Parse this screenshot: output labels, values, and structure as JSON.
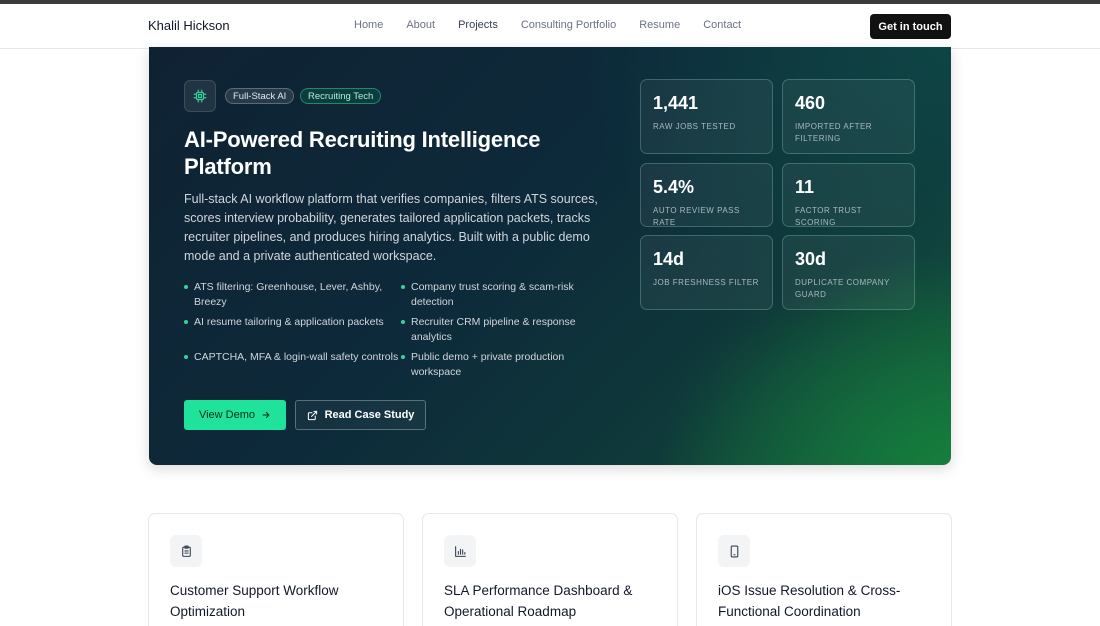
{
  "nav": {
    "brand": "Khalil Hickson",
    "links": [
      "Home",
      "About",
      "Projects",
      "Consulting Portfolio",
      "Resume",
      "Contact"
    ],
    "active": "Projects",
    "cta": "Get in touch"
  },
  "hero": {
    "tags": [
      "Full-Stack AI",
      "Recruiting Tech"
    ],
    "title": "AI-Powered Recruiting Intelligence Platform",
    "description": "Full-stack AI workflow platform that verifies companies, filters ATS sources, scores interview probability, generates tailored application packets, tracks recruiter pipelines, and produces hiring analytics. Built with a public demo mode and a private authenticated workspace.",
    "bullets": [
      "ATS filtering: Greenhouse, Lever, Ashby, Breezy",
      "Company trust scoring & scam-risk detection",
      "AI resume tailoring & application packets",
      "Recruiter CRM pipeline & response analytics",
      "CAPTCHA, MFA & login-wall safety controls",
      "Public demo + private production workspace"
    ],
    "primary_button": "View Demo",
    "secondary_button": "Read Case Study",
    "stats": [
      {
        "value": "1,441",
        "label": "RAW JOBS TESTED"
      },
      {
        "value": "460",
        "label": "IMPORTED AFTER FILTERING"
      },
      {
        "value": "5.4%",
        "label": "AUTO REVIEW PASS RATE"
      },
      {
        "value": "11",
        "label": "FACTOR TRUST SCORING"
      },
      {
        "value": "14d",
        "label": "JOB FRESHNESS FILTER"
      },
      {
        "value": "30d",
        "label": "DUPLICATE COMPANY GUARD"
      }
    ]
  },
  "cards": [
    {
      "icon": "clipboard-icon",
      "title": "Customer Support Workflow Optimization"
    },
    {
      "icon": "bar-chart-icon",
      "title": "SLA Performance Dashboard & Operational Roadmap"
    },
    {
      "icon": "smartphone-icon",
      "title": "iOS Issue Resolution & Cross-Functional Coordination"
    }
  ],
  "colors": {
    "accent": "#1fe39a",
    "bullet_dot": "#34d399",
    "hero_dark": "#0f2233",
    "hero_green": "#15803d"
  }
}
